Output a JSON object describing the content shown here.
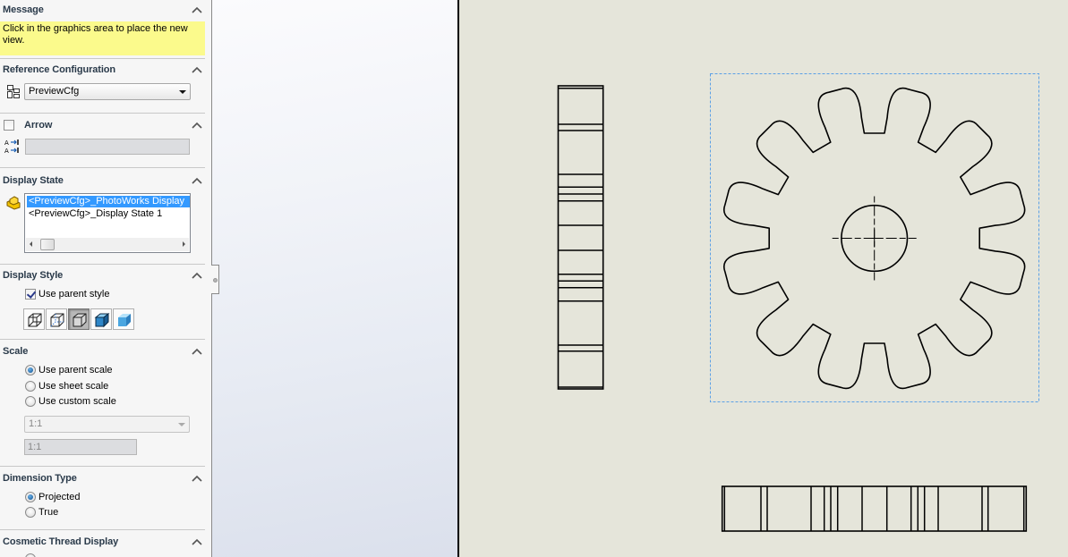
{
  "panel": {
    "message": {
      "title": "Message",
      "text": "Click in the graphics area to place the new view."
    },
    "reference_configuration": {
      "title": "Reference Configuration",
      "icon": "configuration-tree-icon",
      "selected": "PreviewCfg"
    },
    "arrow": {
      "title": "Arrow",
      "checked": false,
      "label_icon": "view-label-arrow-icon",
      "label_value": ""
    },
    "display_state": {
      "title": "Display State",
      "icon": "display-state-icon",
      "items": [
        {
          "label": "<PreviewCfg>_PhotoWorks Display",
          "selected": true
        },
        {
          "label": "<PreviewCfg>_Display State 1",
          "selected": false
        }
      ]
    },
    "display_style": {
      "title": "Display Style",
      "use_parent_label": "Use parent style",
      "use_parent_checked": true,
      "buttons": [
        {
          "name": "wireframe",
          "icon": "wireframe-icon",
          "pressed": false
        },
        {
          "name": "hidden-lines-visible",
          "icon": "hidden-lines-visible-icon",
          "pressed": false
        },
        {
          "name": "hidden-lines-removed",
          "icon": "hidden-lines-removed-icon",
          "pressed": true
        },
        {
          "name": "shaded-with-edges",
          "icon": "shaded-with-edges-icon",
          "pressed": false
        },
        {
          "name": "shaded",
          "icon": "shaded-icon",
          "pressed": false
        }
      ]
    },
    "scale": {
      "title": "Scale",
      "options": [
        {
          "label": "Use parent scale",
          "checked": true
        },
        {
          "label": "Use sheet scale",
          "checked": false
        },
        {
          "label": "Use custom scale",
          "checked": false
        }
      ],
      "custom_select": "1:1",
      "custom_value": "1:1"
    },
    "dimension_type": {
      "title": "Dimension Type",
      "options": [
        {
          "label": "Projected",
          "checked": true
        },
        {
          "label": "True",
          "checked": false
        }
      ]
    },
    "cosmetic_thread": {
      "title": "Cosmetic Thread Display"
    }
  },
  "sheet": {
    "background": "#e5e5da",
    "line_color": "#000000",
    "selection_box_color": "#5aa0e6",
    "gear": {
      "teeth": 12,
      "has_center_hole": true,
      "has_centerlines": true
    },
    "views": [
      "side-view",
      "front-view",
      "bottom-view"
    ]
  }
}
